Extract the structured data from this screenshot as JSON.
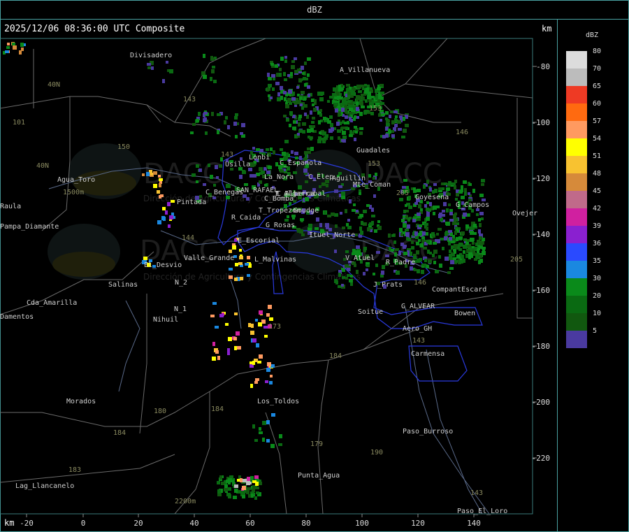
{
  "header": {
    "title": "dBZ"
  },
  "map": {
    "timestamp": "2025/12/06 08:36:00 UTC Composite",
    "unit_top": "km",
    "unit_bottom": "km",
    "x_ticks": [
      "-20",
      "0",
      "20",
      "40",
      "60",
      "80",
      "100",
      "120",
      "140"
    ],
    "y_ticks": [
      "-80",
      "-100",
      "-120",
      "-140",
      "-160",
      "-180",
      "-200",
      "-220"
    ],
    "places": [
      "Divisadero",
      "A_Villanueva",
      "Guadales",
      "La_Nora",
      "C_Espanola",
      "Usilla",
      "C_Elep",
      "Aguillin",
      "Mte_Coman",
      "SAN_RAFAEL",
      "C_Benegas",
      "C_Alberca",
      "C_Bomba",
      "E_Algarrabal",
      "T_Tropezon",
      "Goudge",
      "R_Caida",
      "G_Rosas",
      "Ituel_Norte",
      "G_Campos",
      "Goyesena",
      "E_Escorial",
      "Pintada",
      "Agua_Toro",
      "Pampa_Diamante",
      "Valle_Grande",
      "El_Desvio",
      "L_Malvinas",
      "V_Atuel",
      "R_Padre",
      "Salinas",
      "N_2",
      "N_1",
      "Nihuil",
      "Cda_Amarilla",
      "J_Prats",
      "CompantEscard",
      "G_ALVEAR",
      "Bowen",
      "Soitue",
      "Aero_GH",
      "Carmensa",
      "Morados",
      "Los_Toldos",
      "Paso_Burroso",
      "Punta_Agua",
      "Lag_Llancanelo",
      "Paso_El_Loro",
      "Ovejer",
      "Raula",
      "Damentos",
      "Lonbi"
    ],
    "routes": [
      "40N",
      "40N",
      "101",
      "143",
      "150",
      "143",
      "153",
      "146",
      "153",
      "205",
      "205",
      "144",
      "173",
      "184",
      "184",
      "180",
      "184",
      "183",
      "179",
      "143",
      "143",
      "190",
      "146"
    ],
    "elevations": [
      "1500m",
      "2200m"
    ],
    "watermark": "DACC",
    "watermark_sub": "Dirección de Agricultura y Contingencias Climáticas"
  },
  "legend": {
    "title": "dBZ",
    "levels": [
      {
        "value": "80",
        "color": "#dcdcdc"
      },
      {
        "value": "70",
        "color": "#bcbcbc"
      },
      {
        "value": "65",
        "color": "#ee3a24"
      },
      {
        "value": "60",
        "color": "#ff6a10"
      },
      {
        "value": "57",
        "color": "#ff9a60"
      },
      {
        "value": "54",
        "color": "#ffff00"
      },
      {
        "value": "51",
        "color": "#f8c230"
      },
      {
        "value": "48",
        "color": "#d68a3a"
      },
      {
        "value": "45",
        "color": "#c06a8a"
      },
      {
        "value": "42",
        "color": "#d020a0"
      },
      {
        "value": "39",
        "color": "#8a20d0"
      },
      {
        "value": "36",
        "color": "#2a4aff"
      },
      {
        "value": "35",
        "color": "#1a88e0"
      },
      {
        "value": "30",
        "color": "#0a8a1a"
      },
      {
        "value": "20",
        "color": "#0a6a12"
      },
      {
        "value": "10",
        "color": "#11580f"
      },
      {
        "value": "5",
        "color": "#4a3aa0"
      }
    ]
  }
}
